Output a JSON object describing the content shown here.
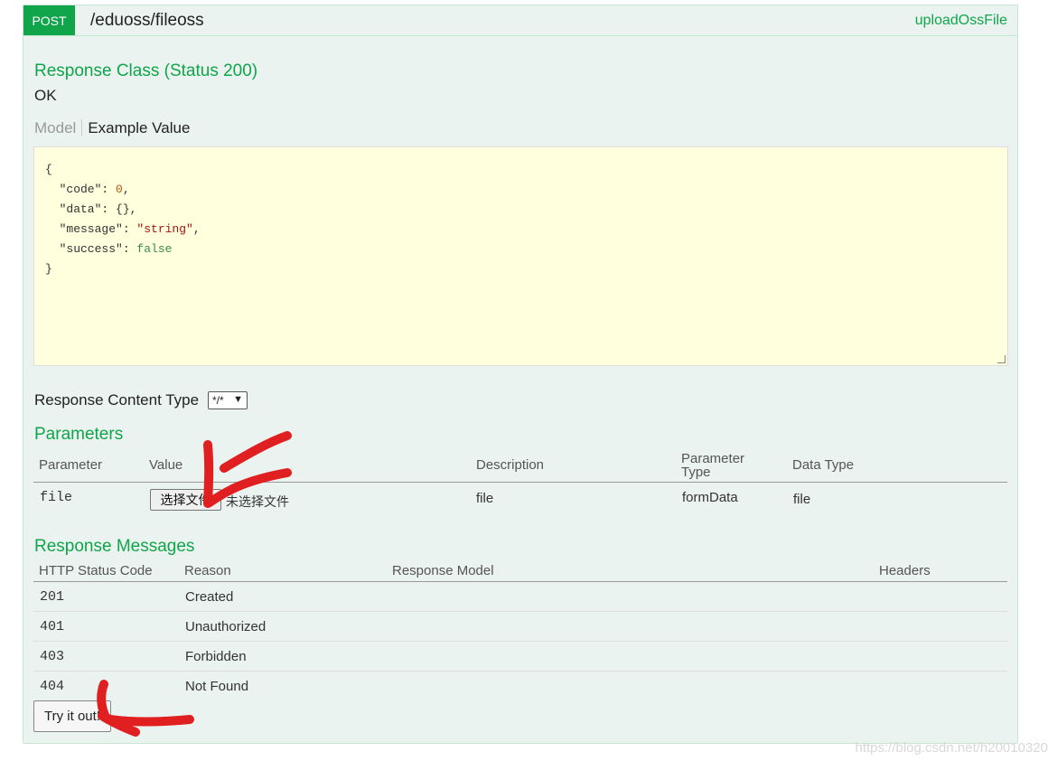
{
  "operation": {
    "method": "POST",
    "path": "/eduoss/fileoss",
    "nickname": "uploadOssFile"
  },
  "response_class": {
    "heading": "Response Class (Status 200)",
    "status_text": "OK",
    "tabs": {
      "model": "Model",
      "example": "Example Value"
    },
    "example_lines": [
      [
        "{"
      ],
      [
        "  \"code\": ",
        "0",
        ","
      ],
      [
        "  \"data\": {},"
      ],
      [
        "  \"message\": ",
        "\"string\"",
        ","
      ],
      [
        "  \"success\": ",
        "false",
        ""
      ],
      [
        "}"
      ]
    ]
  },
  "response_content_type": {
    "label": "Response Content Type",
    "selected": "*/*"
  },
  "parameters": {
    "heading": "Parameters",
    "columns": [
      "Parameter",
      "Value",
      "Description",
      "Parameter Type",
      "Data Type"
    ],
    "rows": [
      {
        "name": "file",
        "button_label": "选择文件",
        "no_file_text": "未选择文件",
        "description": "file",
        "param_type": "formData",
        "data_type": "file"
      }
    ]
  },
  "response_messages": {
    "heading": "Response Messages",
    "columns": [
      "HTTP Status Code",
      "Reason",
      "Response Model",
      "Headers"
    ],
    "rows": [
      {
        "code": "201",
        "reason": "Created"
      },
      {
        "code": "401",
        "reason": "Unauthorized"
      },
      {
        "code": "403",
        "reason": "Forbidden"
      },
      {
        "code": "404",
        "reason": "Not Found"
      }
    ]
  },
  "try_button": "Try it out!",
  "watermark": "https://blog.csdn.net/h20010320",
  "colors": {
    "accent_green": "#10a54a",
    "panel_bg": "#ebf3f0",
    "example_bg": "#ffffdd",
    "annotation_red": "#e02020"
  }
}
